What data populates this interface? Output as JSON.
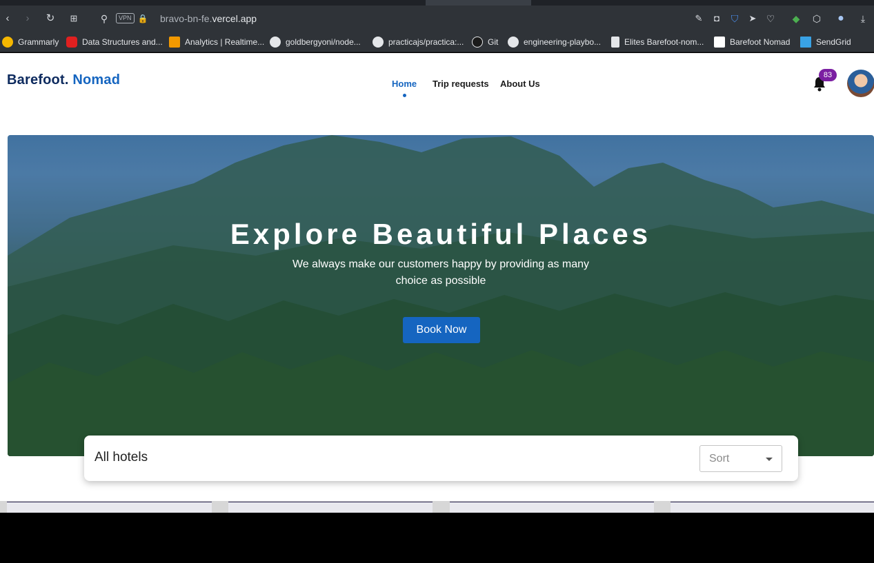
{
  "browser": {
    "url_host_prefix": "bravo-bn-fe.",
    "url_host_domain": "vercel.app",
    "vpn_label": "VPN",
    "bookmarks": [
      {
        "label": "Grammarly",
        "icon": "grammarly-icon",
        "color": "#f5b700"
      },
      {
        "label": "Data Structures and...",
        "icon": "youtube-icon",
        "color": "#e02020"
      },
      {
        "label": "Analytics | Realtime...",
        "icon": "analytics-icon",
        "color": "#f29900"
      },
      {
        "label": "goldbergyoni/node...",
        "icon": "github-icon",
        "color": "#e4e6e9"
      },
      {
        "label": "practicajs/practica:...",
        "icon": "github-icon",
        "color": "#e4e6e9"
      },
      {
        "label": "Git",
        "icon": "git-icon",
        "color": "#1b1b1b"
      },
      {
        "label": "engineering-playbo...",
        "icon": "github-icon",
        "color": "#e4e6e9"
      },
      {
        "label": "Elites Barefoot-nom...",
        "icon": "document-icon",
        "color": "#e4e6e9"
      },
      {
        "label": "Barefoot Nomad",
        "icon": "bn-icon",
        "color": "#ffffff"
      },
      {
        "label": "SendGrid",
        "icon": "sendgrid-icon",
        "color": "#39a2e5"
      }
    ]
  },
  "header": {
    "logo_part1": "Barefoot.",
    "logo_part2": "Nomad",
    "nav": [
      {
        "label": "Home",
        "active": true
      },
      {
        "label": "Trip requests",
        "active": false
      },
      {
        "label": "About Us",
        "active": false
      }
    ],
    "notification_count": "83"
  },
  "hero": {
    "title": "Explore Beautiful Places",
    "subtitle_line1": "We always make our customers happy by providing as many",
    "subtitle_line2": "choice as possible",
    "cta": "Book Now"
  },
  "listing": {
    "title": "All hotels",
    "sort_label": "Sort"
  },
  "colors": {
    "brand_dark": "#0d2a5e",
    "brand_blue": "#1565c0",
    "badge": "#7b1fa2"
  }
}
